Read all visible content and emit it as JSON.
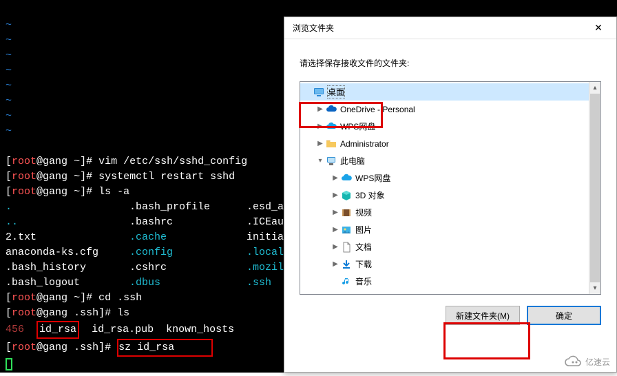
{
  "terminal": {
    "lines": [
      {
        "type": "tilde",
        "text": "~"
      },
      {
        "type": "tilde",
        "text": "~"
      },
      {
        "type": "tilde",
        "text": "~"
      },
      {
        "type": "tilde",
        "text": "~"
      },
      {
        "type": "tilde",
        "text": "~"
      },
      {
        "type": "tilde",
        "text": "~"
      },
      {
        "type": "tilde",
        "text": "~"
      },
      {
        "type": "tilde",
        "text": "~"
      },
      {
        "type": "blank",
        "text": ""
      }
    ],
    "p1_user": "root",
    "p1_at": "@",
    "p1_host": "gang",
    "p1_path": "~",
    "p1_cmd": "vim /etc/ssh/sshd_config",
    "p2_user": "root",
    "p2_host": "gang",
    "p2_path": "~",
    "p2_cmd": "systemctl restart sshd",
    "p3_user": "root",
    "p3_host": "gang",
    "p3_path": "~",
    "p3_cmd": "ls -a",
    "row1_a": ".",
    "row1_b": ".bash_profile",
    "row1_c": ".esd_a",
    "row2_a": "..",
    "row2_b": ".bashrc",
    "row2_c": ".ICEau",
    "row3_a": "2.txt",
    "row3_b": ".cache",
    "row3_c": "initia",
    "row4_a": "anaconda-ks.cfg",
    "row4_b": ".config",
    "row4_c": ".local",
    "row5_a": ".bash_history",
    "row5_b": ".cshrc",
    "row5_c": ".mozil",
    "row6_a": ".bash_logout",
    "row6_b": ".dbus",
    "row6_c": ".ssh",
    "p4_user": "root",
    "p4_host": "gang",
    "p4_path": "~",
    "p4_cmd": "cd .ssh",
    "p5_user": "root",
    "p5_host": "gang",
    "p5_path": ".ssh",
    "p5_cmd": "ls",
    "ls_num": "456",
    "ls_file1": "id_rsa",
    "ls_file2": "id_rsa.pub",
    "ls_file3": "known_hosts",
    "p6_user": "root",
    "p6_host": "gang",
    "p6_path": ".ssh",
    "p6_cmd": "sz id_rsa"
  },
  "dialog": {
    "title": "浏览文件夹",
    "close": "✕",
    "prompt": "请选择保存接收文件的文件夹:",
    "tree": {
      "desktop": "桌面",
      "onedrive": "OneDrive - Personal",
      "wps1": "WPS网盘",
      "admin": "Administrator",
      "thispc": "此电脑",
      "wps2": "WPS网盘",
      "obj3d": "3D 对象",
      "video": "视频",
      "pictures": "图片",
      "docs": "文档",
      "downloads": "下载",
      "music": "音乐"
    },
    "buttons": {
      "new_folder": "新建文件夹(M)",
      "ok": "确定"
    }
  },
  "watermark": "亿速云"
}
